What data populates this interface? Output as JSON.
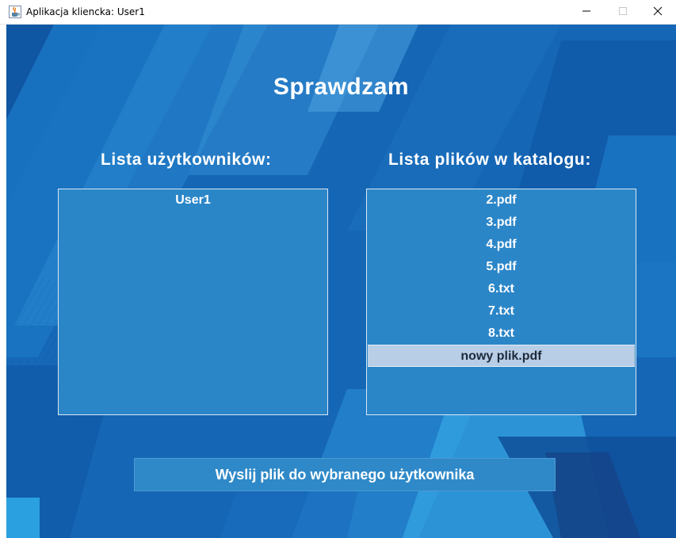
{
  "window": {
    "title": "Aplikacja kliencka: User1"
  },
  "header": {
    "title": "Sprawdzam"
  },
  "users": {
    "title": "Lista użytkowników:",
    "items": [
      "User1"
    ]
  },
  "files": {
    "title": "Lista plików w katalogu:",
    "items": [
      "2.pdf",
      "3.pdf",
      "4.pdf",
      "5.pdf",
      "6.txt",
      "7.txt",
      "8.txt",
      "nowy plik.pdf"
    ],
    "selected": "nowy plik.pdf"
  },
  "actions": {
    "send_label": "Wyslij plik do wybranego użytkownika"
  },
  "icons": {
    "app": "java-cup-icon",
    "minimize": "minimize-icon",
    "maximize": "maximize-icon",
    "close": "close-icon"
  },
  "colors": {
    "background": "#1565b4",
    "list_background": "#2b86c8",
    "selection": "#b8cde6",
    "button": "#2f89c8",
    "text": "#ffffff"
  }
}
